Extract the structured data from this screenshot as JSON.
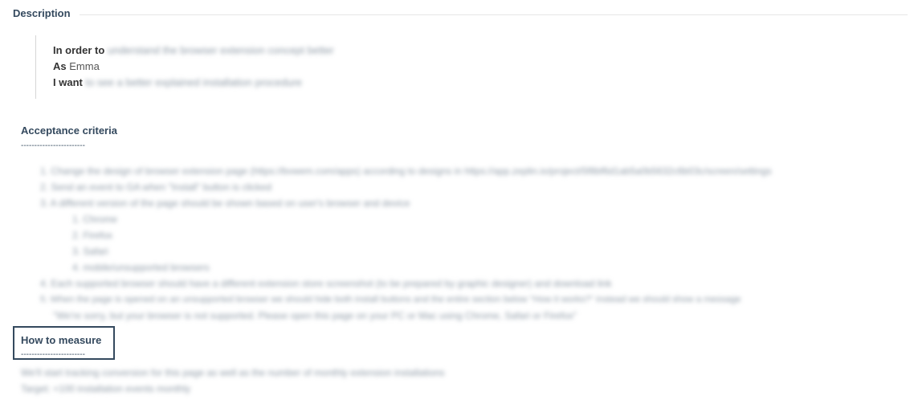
{
  "description": {
    "legend": "Description",
    "story": {
      "in_order_to_label": "In order to",
      "in_order_to_value": "understand the browser extension concept better",
      "as_label": "As",
      "as_value": "Emma",
      "i_want_label": "I want",
      "i_want_value": "to see a better explained installation procedure"
    }
  },
  "acceptance": {
    "title": "Acceptance criteria",
    "dashes": "------------------------",
    "items": [
      "1.  Change the design of browser extension page (https://bvwem.com/apps) according to designs in https://app.zeplin.io/project/5f8bf6d1ab5a0b5632c6b03c/screen/settings",
      "2.  Send an event to GA when \"Install\" button is clicked",
      "3.  A different version of the page should be shown based on user's browser and device",
      "1.  Chrome",
      "2.  Firefox",
      "3.  Safari",
      "4.  mobile/unsupported browsers",
      "4.  Each supported browser should have a different extension store screenshot (to be prepared by graphic designer) and download link",
      "5.  When the page is opened on an unsupported browser we should hide both install buttons and the entire section below \"How it works?\" Instead we should show a message",
      "\"We're sorry, but your browser is not supported. Please open this page on your PC or Mac using Chrome, Safari or Firefox\""
    ]
  },
  "measure": {
    "title": "How to measure",
    "dashes": "------------------------",
    "lines": [
      "We'll start tracking conversion for this page as well as the number of monthly extension installations",
      "Target: +100 installation events monthly"
    ]
  }
}
